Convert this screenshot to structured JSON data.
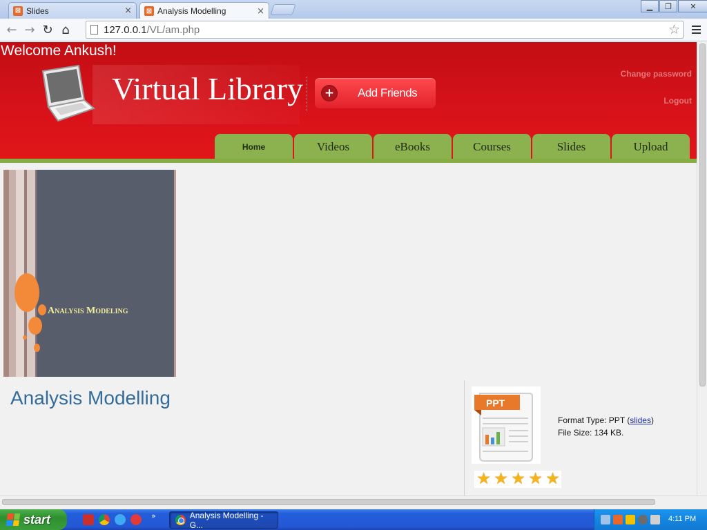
{
  "browser": {
    "tabs": [
      {
        "title": "Slides",
        "active": false
      },
      {
        "title": "Analysis Modelling",
        "active": true
      }
    ],
    "favicon_letter": "⊠",
    "close_glyph": "×",
    "url_host": "127.0.0.1",
    "url_path": "/VL/am.php",
    "back_glyph": "←",
    "forward_glyph": "→",
    "reload_glyph": "↻",
    "home_glyph": "⌂",
    "star_glyph": "☆",
    "window_min_glyph": "▁",
    "window_max_glyph": "❐",
    "window_close_glyph": "✕"
  },
  "header": {
    "welcome": "Welcome Ankush!",
    "site_title": "Virtual Library",
    "add_friends": "Add Friends",
    "add_plus": "+",
    "change_password": "Change password",
    "logout": "Logout",
    "nav": [
      "Home",
      "Videos",
      "eBooks",
      "Courses",
      "Slides",
      "Upload"
    ]
  },
  "item": {
    "cover_title": "Analysis Modeling",
    "title": "Analysis Modelling",
    "format_label": "Format Type: PPT (",
    "format_link": "slides",
    "format_close": ")",
    "size_label": "File Size: 134 KB.",
    "icon_label": "PPT",
    "rating": 5,
    "star_glyph": "★"
  },
  "taskbar": {
    "start": "start",
    "quicklaunch_more": "»",
    "task_title": "Analysis Modelling - G...",
    "clock": "4:11 PM"
  },
  "colors": {
    "header_red": "#d8121a",
    "nav_green": "#8bb24f",
    "title_blue": "#336b9a",
    "star_gold": "#f5b41c"
  }
}
